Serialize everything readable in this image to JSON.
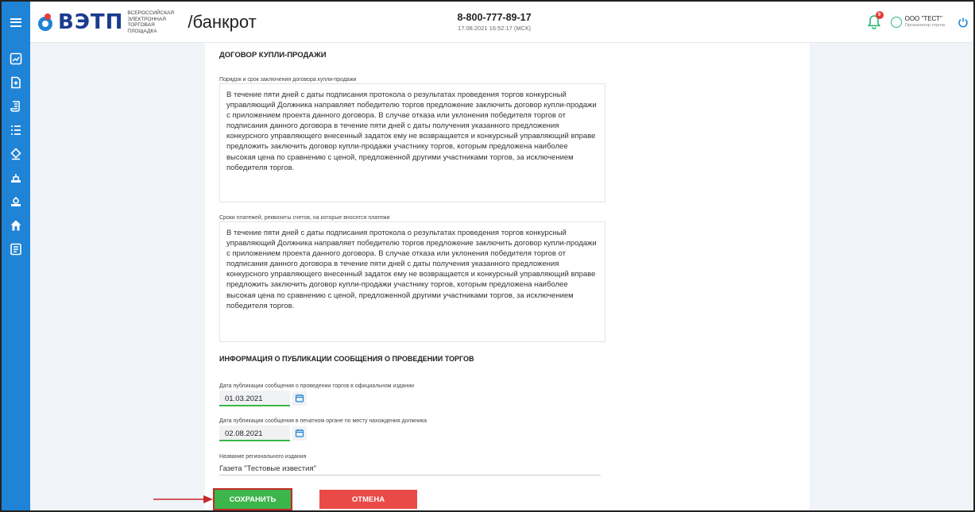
{
  "header": {
    "logo_text": "ВЭТП",
    "logo_subtitle": [
      "ВСЕРОССИЙСКАЯ",
      "ЭЛЕКТРОННАЯ",
      "ТОРГОВАЯ ПЛОЩАДКА"
    ],
    "logo_suffix": "/банкрот",
    "phone": "8-800-777-89-17",
    "datetime": "17.08.2021 16:52:17 (МСК)",
    "notifications_count": "9",
    "user_name": "ООО \"ТЕСТ\"",
    "user_role": "Организатор торгов"
  },
  "sidebar": {
    "items": [
      "menu-icon",
      "document-add-icon",
      "scroll-icon",
      "list-icon",
      "auction-icon",
      "lot-icon",
      "lot-alt-icon",
      "home-icon",
      "report-icon"
    ]
  },
  "contract": {
    "title": "ДОГОВОР КУПЛИ-ПРОДАЖИ",
    "procedure_label": "Порядок и срок заключения договора купли-продажи",
    "procedure_text": "В течение пяти дней с даты подписания протокола о результатах проведения торгов конкурсный управляющий Должника направляет победителю торгов предложение заключить договор купли-продажи с приложением проекта данного договора. В случае отказа или уклонения победителя торгов от подписания данного договора в течение пяти дней с даты получения указанного предложения конкурсного управляющего внесенный задаток ему не возвращается и конкурсный управляющий вправе предложить заключить договор купли-продажи участнику торгов, которым предложена наиболее высокая цена по сравнению с ценой, предложенной другими участниками торгов, за исключением победителя торгов.",
    "payments_label": "Сроки платежей, реквизиты счетов, на которые вносятся платежи",
    "payments_text": "В течение пяти дней с даты подписания протокола о результатах проведения торгов конкурсный управляющий Должника направляет победителю торгов предложение заключить договор купли-продажи с приложением проекта данного договора. В случае отказа или уклонения победителя торгов от подписания данного договора в течение пяти дней с даты получения указанного предложения конкурсного управляющего внесенный задаток ему не возвращается и конкурсный управляющий вправе предложить заключить договор купли-продажи участнику торгов, которым предложена наиболее высокая цена по сравнению с ценой, предложенной другими участниками торгов, за исключением победителя торгов."
  },
  "publication": {
    "title": "ИНФОРМАЦИЯ О ПУБЛИКАЦИИ СООБЩЕНИЯ О ПРОВЕДЕНИИ ТОРГОВ",
    "official_date_label": "Дата публикации сообщения о проведении торгов в официальном издании",
    "official_date": "01.03.2021",
    "print_date_label": "Дата публикации сообщения в печатном органе по месту нахождения должника",
    "print_date": "02.08.2021",
    "regional_label": "Название регионального издания",
    "regional_value": "Газета \"Тестовые известия\""
  },
  "actions": {
    "save_label": "СОХРАНИТЬ",
    "cancel_label": "ОТМЕНА"
  },
  "colors": {
    "brand_blue": "#1f83d6",
    "save_green": "#3cb54a",
    "cancel_red": "#e94a47",
    "annotation_red": "#c62828"
  }
}
